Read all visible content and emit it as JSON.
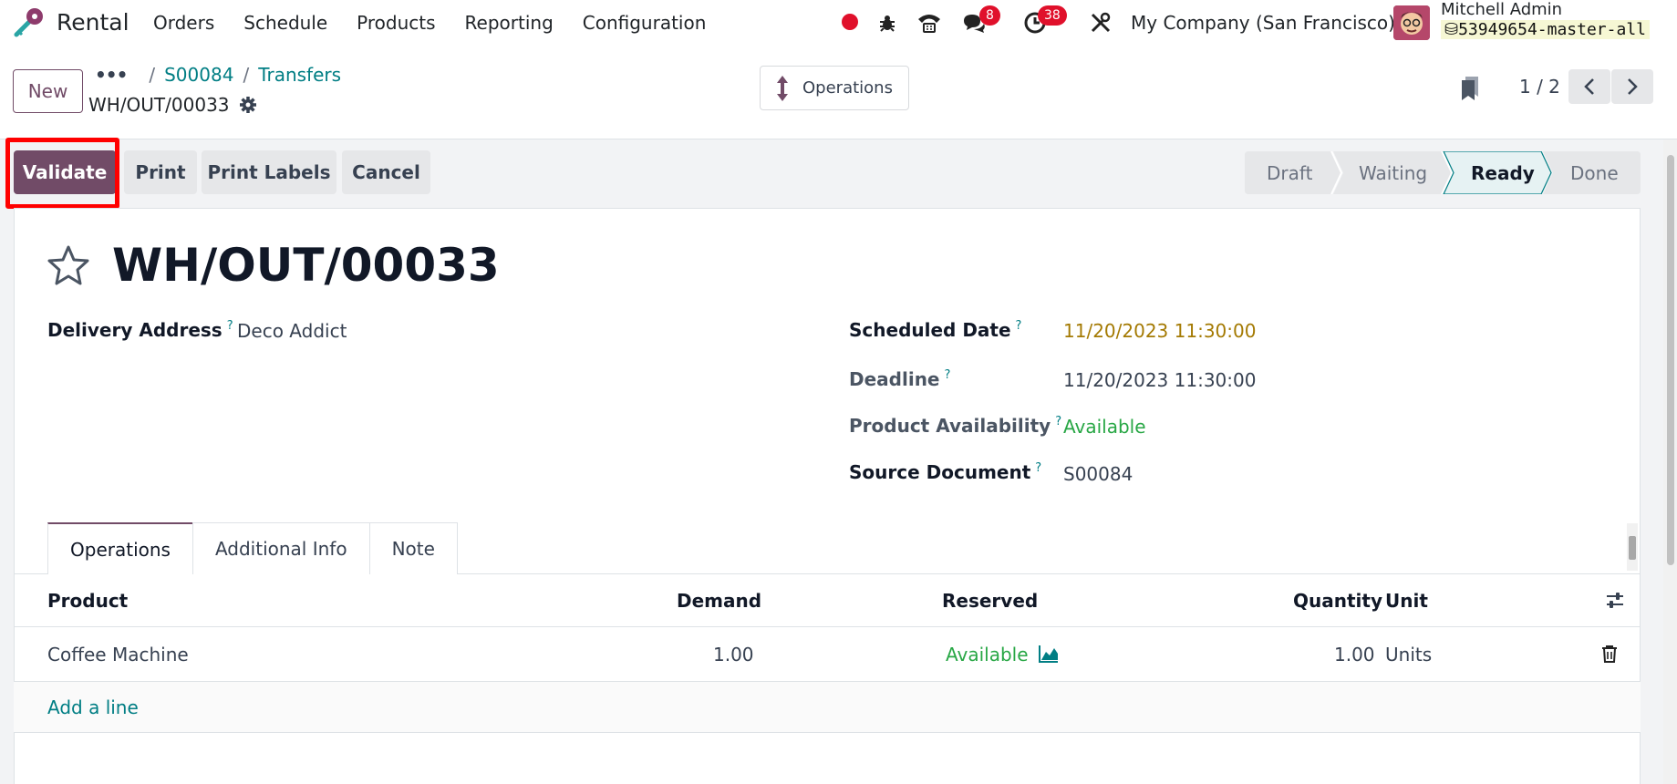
{
  "navbar": {
    "app_name": "Rental",
    "menu": [
      "Orders",
      "Schedule",
      "Products",
      "Reporting",
      "Configuration"
    ],
    "messages_badge": "8",
    "activities_badge": "38",
    "company": "My Company (San Francisco)",
    "user_name": "Mitchell Admin",
    "db_name": "53949654-master-all"
  },
  "control": {
    "new_label": "New",
    "breadcrumb": [
      "S00084",
      "Transfers"
    ],
    "record_name": "WH/OUT/00033",
    "operations_label": "Operations",
    "pager": "1 / 2"
  },
  "actions": {
    "validate": "Validate",
    "print": "Print",
    "print_labels": "Print Labels",
    "cancel": "Cancel"
  },
  "status": {
    "stages": [
      "Draft",
      "Waiting",
      "Ready",
      "Done"
    ],
    "active": "Ready"
  },
  "form": {
    "title": "WH/OUT/00033",
    "delivery_address_label": "Delivery Address",
    "delivery_address": "Deco Addict",
    "scheduled_date_label": "Scheduled Date",
    "scheduled_date": "11/20/2023 11:30:00",
    "deadline_label": "Deadline",
    "deadline": "11/20/2023 11:30:00",
    "availability_label": "Product Availability",
    "availability": "Available",
    "source_doc_label": "Source Document",
    "source_doc": "S00084",
    "help_mark": "?"
  },
  "tabs": [
    "Operations",
    "Additional Info",
    "Note"
  ],
  "table": {
    "headers": {
      "product": "Product",
      "demand": "Demand",
      "reserved": "Reserved",
      "quantity": "Quantity",
      "unit": "Unit"
    },
    "rows": [
      {
        "product": "Coffee Machine",
        "demand": "1.00",
        "reserved": "Available",
        "quantity": "1.00",
        "unit": "Units"
      }
    ],
    "add_line": "Add a line"
  },
  "colors": {
    "brand": "#714b67",
    "link": "#017e84",
    "success": "#28a745",
    "warning_date": "#a47a03",
    "badge": "#e0102b"
  }
}
